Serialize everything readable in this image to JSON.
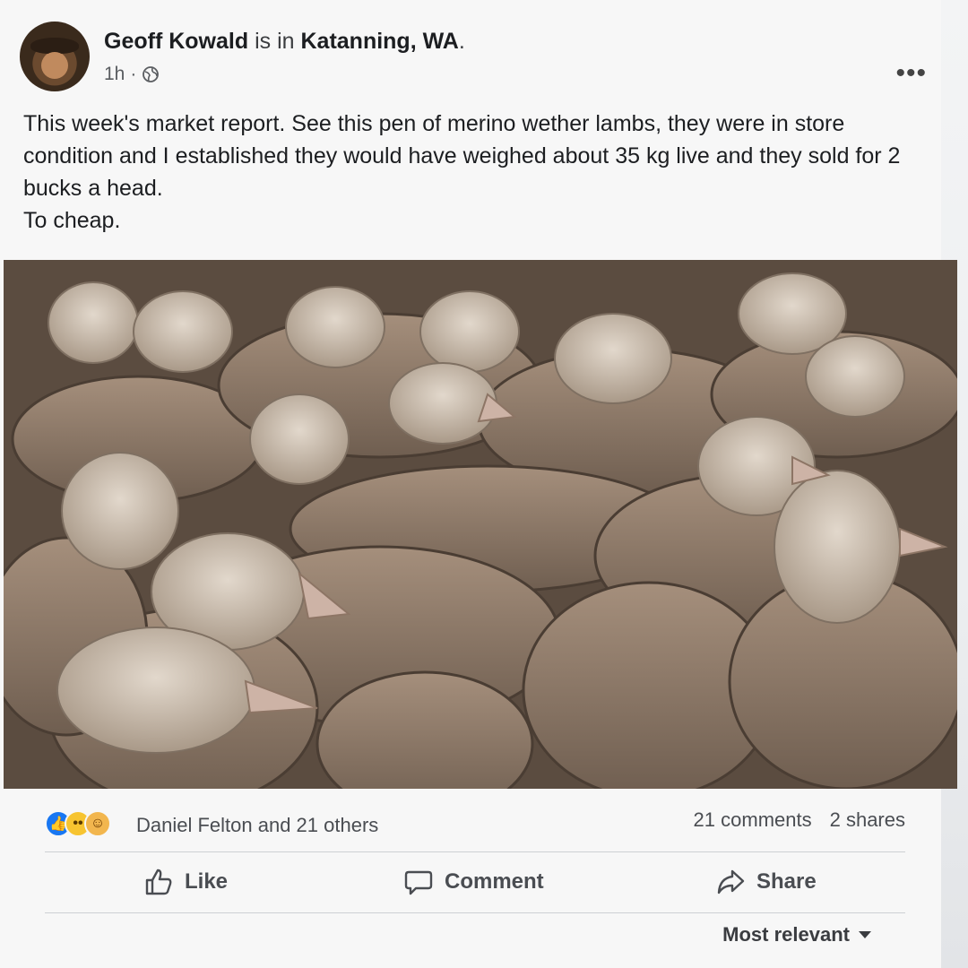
{
  "post": {
    "author": "Geoff Kowald",
    "checkin_text": "is in",
    "location": "Katanning, WA",
    "location_suffix": ".",
    "time": "1h",
    "time_separator": "·",
    "privacy_icon": "globe-icon",
    "more_icon": "more-options-icon",
    "more_glyph": "•••",
    "body_lines": [
      "This week's market report. See this pen of merino wether lambs, they were in store condition and I established they would have weighed about 35 kg live and they sold for 2 bucks a head.",
      "To cheap."
    ]
  },
  "stats": {
    "reaction_icons": [
      "like-reaction-icon",
      "wow-reaction-icon",
      "care-reaction-icon"
    ],
    "reactors": "Daniel Felton and 21 others",
    "comments": "21 comments",
    "shares": "2 shares"
  },
  "actions": {
    "like_label": "Like",
    "comment_label": "Comment",
    "share_label": "Share"
  },
  "comments_sort": {
    "label": "Most relevant"
  },
  "colors": {
    "like_blue": "#1877f2",
    "text_primary": "#1c1e21",
    "text_secondary": "#4a4d52"
  }
}
